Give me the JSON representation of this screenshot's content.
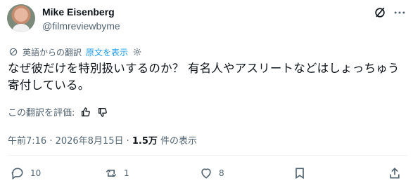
{
  "author": {
    "name": "Mike Eisenberg",
    "handle": "@filmreviewbyme"
  },
  "translation": {
    "label": "英語からの翻訳",
    "show_original": "原文を表示"
  },
  "tweet": {
    "text_line1": "なぜ彼だけを特別扱いするのか？ 有名人やアスリートなどはしょっちゅう",
    "text_line2": "寄付している。"
  },
  "rating": {
    "label": "この翻訳を評価:"
  },
  "meta": {
    "time_date": "午前7:16 · 2026年8月15日 · ",
    "views_count": "1.5万",
    "views_label": " 件の表示"
  },
  "actions": {
    "replies": "10",
    "reposts": "1",
    "likes": "8"
  },
  "icons": {
    "grok": "grok-icon",
    "more": "more-icon",
    "translate": "translate-icon",
    "settings": "gear-icon",
    "thumbs_up": "thumbs-up-icon",
    "thumbs_down": "thumbs-down-icon",
    "reply": "reply-icon",
    "repost": "repost-icon",
    "like": "heart-icon",
    "bookmark": "bookmark-icon",
    "share": "share-icon"
  },
  "colors": {
    "text": "#0f1419",
    "secondary": "#536471",
    "accent": "#1d9bf0"
  }
}
